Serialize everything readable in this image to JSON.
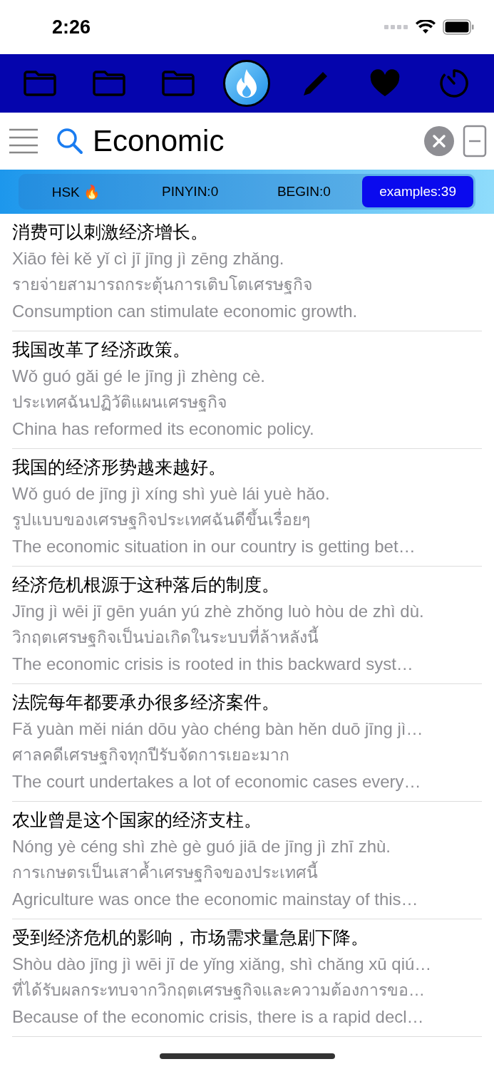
{
  "status_bar": {
    "time": "2:26"
  },
  "toolbar": [
    {
      "selected": false
    },
    {
      "selected": false
    },
    {
      "selected": false
    },
    {
      "selected": true
    },
    {
      "selected": false
    },
    {
      "selected": false
    },
    {
      "selected": false
    }
  ],
  "search": {
    "value": "Economic"
  },
  "segments": [
    {
      "label": "HSK 🔥",
      "selected": false
    },
    {
      "label": "PINYIN:0",
      "selected": false
    },
    {
      "label": "BEGIN:0",
      "selected": false
    },
    {
      "label": "examples:39",
      "selected": true
    }
  ],
  "examples": [
    {
      "hanzi": "消费可以刺激经济增长。",
      "pinyin": "Xiāo fèi kě yǐ cì jī jīng jì zēng zhǎng.",
      "thai": "รายจ่ายสามารถกระตุ้นการเติบโตเศรษฐกิจ",
      "english": "Consumption can stimulate economic growth."
    },
    {
      "hanzi": "我国改革了经济政策。",
      "pinyin": "Wǒ guó gǎi gé le jīng jì zhèng cè.",
      "thai": "ประเทศฉันปฏิวัติแผนเศรษฐกิจ",
      "english": "China has reformed its economic policy."
    },
    {
      "hanzi": "我国的经济形势越来越好。",
      "pinyin": "Wǒ guó de jīng jì xíng shì yuè lái yuè hǎo.",
      "thai": "รูปแบบของเศรษฐกิจประเทศฉันดีขึ้นเรื่อยๆ",
      "english": "The economic situation in our country is getting bet…"
    },
    {
      "hanzi": "经济危机根源于这种落后的制度。",
      "pinyin": "Jīng jì wēi jī gēn yuán yú zhè zhǒng luò hòu de zhì dù.",
      "thai": "วิกฤตเศรษฐกิจเป็นบ่อเกิดในระบบที่ล้าหลังนี้",
      "english": "The economic crisis is rooted in this backward syst…"
    },
    {
      "hanzi": "法院每年都要承办很多经济案件。",
      "pinyin": "Fǎ yuàn měi nián dōu yào chéng bàn hěn duō jīng jì…",
      "thai": "ศาลคดีเศรษฐกิจทุกปีรับจัดการเยอะมาก",
      "english": "The court undertakes a lot of economic cases every…"
    },
    {
      "hanzi": "农业曾是这个国家的经济支柱。",
      "pinyin": "Nóng yè céng shì zhè gè guó jiā de jīng jì zhī zhù.",
      "thai": "การเกษตรเป็นเสาค้ำเศรษฐกิจของประเทศนี้",
      "english": "Agriculture was once the economic mainstay of this…"
    },
    {
      "hanzi": "受到经济危机的影响，市场需求量急剧下降。",
      "pinyin": "Shòu dào jīng jì wēi jī de yǐng xiǎng, shì chǎng xū qiú…",
      "thai": "ที่ได้รับผลกระทบจากวิกฤตเศรษฐกิจและความต้องการขอ…",
      "english": "Because of the economic crisis, there is a rapid decl…"
    }
  ]
}
